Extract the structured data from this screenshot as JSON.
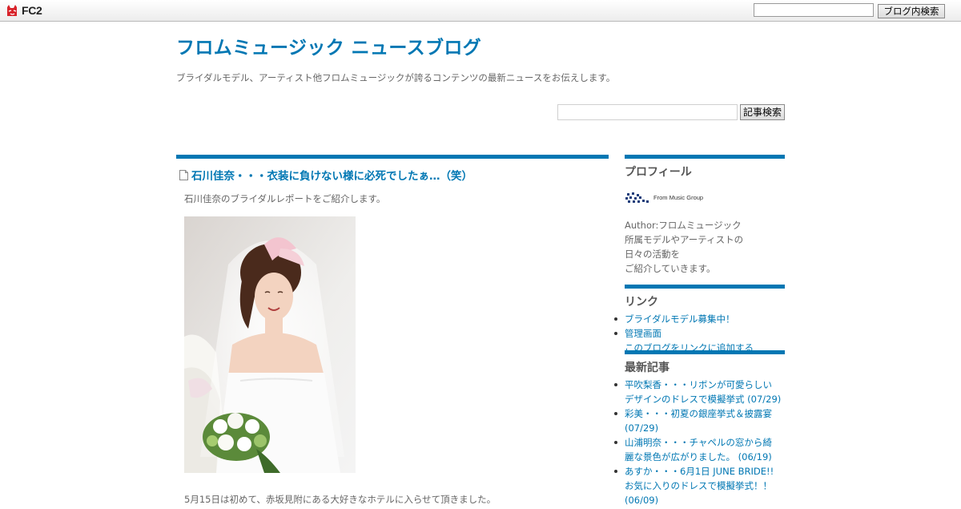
{
  "topbar": {
    "brand": "FC2",
    "search_value": "",
    "search_button": "ブログ内検索"
  },
  "blog": {
    "title": "フロムミュージック ニュースブログ",
    "description": "ブライダルモデル、アーティスト他フロムミュージックが誇るコンテンツの最新ニュースをお伝えします。",
    "search_value": "",
    "search_button": "記事検索"
  },
  "entry": {
    "title": "石川佳奈・・・衣装に負けない様に必死でしたぁ…（笑）",
    "intro": "石川佳奈のブライダルレポートをご紹介します。",
    "body": "5月15日は初めて、赤坂見附にある大好きなホテルに入らせて頂きました。"
  },
  "sidebar": {
    "profile": {
      "title": "プロフィール",
      "logo_text": "From Music Group",
      "lines": [
        "Author:フロムミュージック",
        "所属モデルやアーティストの",
        "日々の活動を",
        "ご紹介していきます。"
      ]
    },
    "links": {
      "title": "リンク",
      "items": [
        "ブライダルモデル募集中！",
        "管理画面"
      ],
      "add_link": "このブログをリンクに追加する"
    },
    "recent": {
      "title": "最新記事",
      "items": [
        [
          "平吹梨香・・・リボンが可愛らしい",
          "デザインのドレスで模擬挙式 (07/29)"
        ],
        [
          "彩美・・・初夏の銀座挙式＆披露宴",
          "(07/29)"
        ],
        [
          "山浦明奈・・・チャペルの窓から綺",
          "麗な景色が広がりました。 (06/19)"
        ],
        [
          "あすか・・・6月1日 JUNE BRIDE!!",
          "お気に入りのドレスで模擬挙式！！",
          "(06/09)"
        ]
      ]
    }
  },
  "colors": {
    "accent": "#0077b3",
    "text": "#666666",
    "heading": "#555555"
  }
}
